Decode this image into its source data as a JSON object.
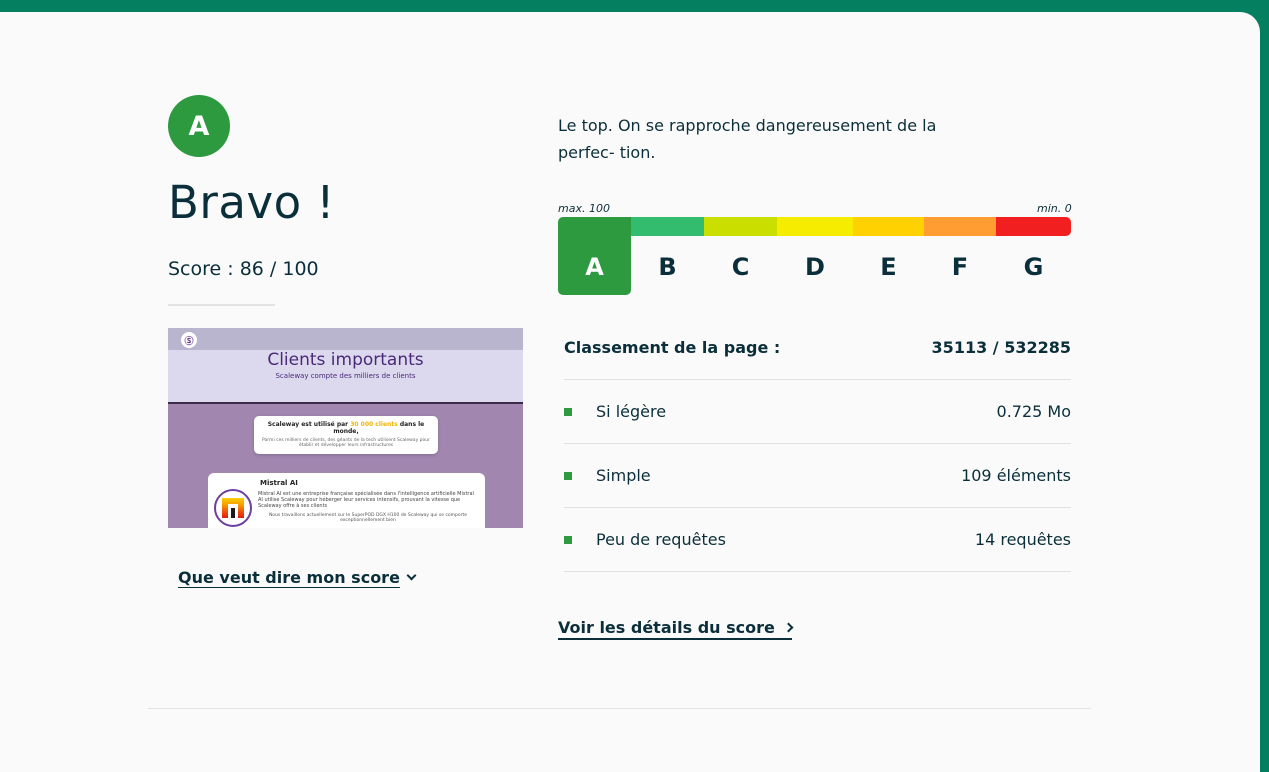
{
  "result": {
    "grade": "A",
    "title": "Bravo !",
    "score_text": "Score : 86 / 100",
    "score_value": 86,
    "description": "Le top. On se rapproche dangereusement de la perfec- tion.",
    "score_link": "Que veut dire mon score"
  },
  "thumbnail": {
    "logo": "Ⓢ",
    "title": "Clients importants",
    "subtitle": "Scaleway compte des milliers de clients",
    "box1_text_pre": "Scaleway est utilisé par ",
    "box1_text_highlight": "30 000 clients",
    "box1_text_post": " dans le monde,",
    "box1_sub": "Parmi ces milliers de clients, des géants de la tech utilisent Scaleway pour établir et développer leurs infrastructures",
    "card_title": "Mistral AI",
    "card_desc": "Mistral AI est une entreprise française spécialisée dans l'intelligence artificielle Mistral AI utilise Scaleway pour héberger leur services intensifs, prouvant la vitesse que Scaleway offre à ses clients",
    "card_quote": "Nous travaillons actuellement sur le SuperPOD DGX H100 de Scaleway qui se comporte exceptionnellement bien"
  },
  "scale": {
    "max_label": "max. 100",
    "min_label": "min. 0",
    "active": "A",
    "grades": [
      {
        "label": "A",
        "color": "#2e9a40"
      },
      {
        "label": "B",
        "color": "#34bc6e"
      },
      {
        "label": "C",
        "color": "#cadf00"
      },
      {
        "label": "D",
        "color": "#f5ec00"
      },
      {
        "label": "E",
        "color": "#ffd100"
      },
      {
        "label": "F",
        "color": "#ff9c32"
      },
      {
        "label": "G",
        "color": "#f11f1f"
      }
    ]
  },
  "ranking": {
    "label": "Classement de la page :",
    "value": "35113 / 532285"
  },
  "metrics": [
    {
      "label": "Si légère",
      "value": "0.725 Mo"
    },
    {
      "label": "Simple",
      "value": "109 éléments"
    },
    {
      "label": "Peu de requêtes",
      "value": "14 requêtes"
    }
  ],
  "detail_link": "Voir les détails du score",
  "colors": {
    "brand": "#047f5f",
    "grade_a": "#2e9a40",
    "text": "#0b2f3a"
  }
}
